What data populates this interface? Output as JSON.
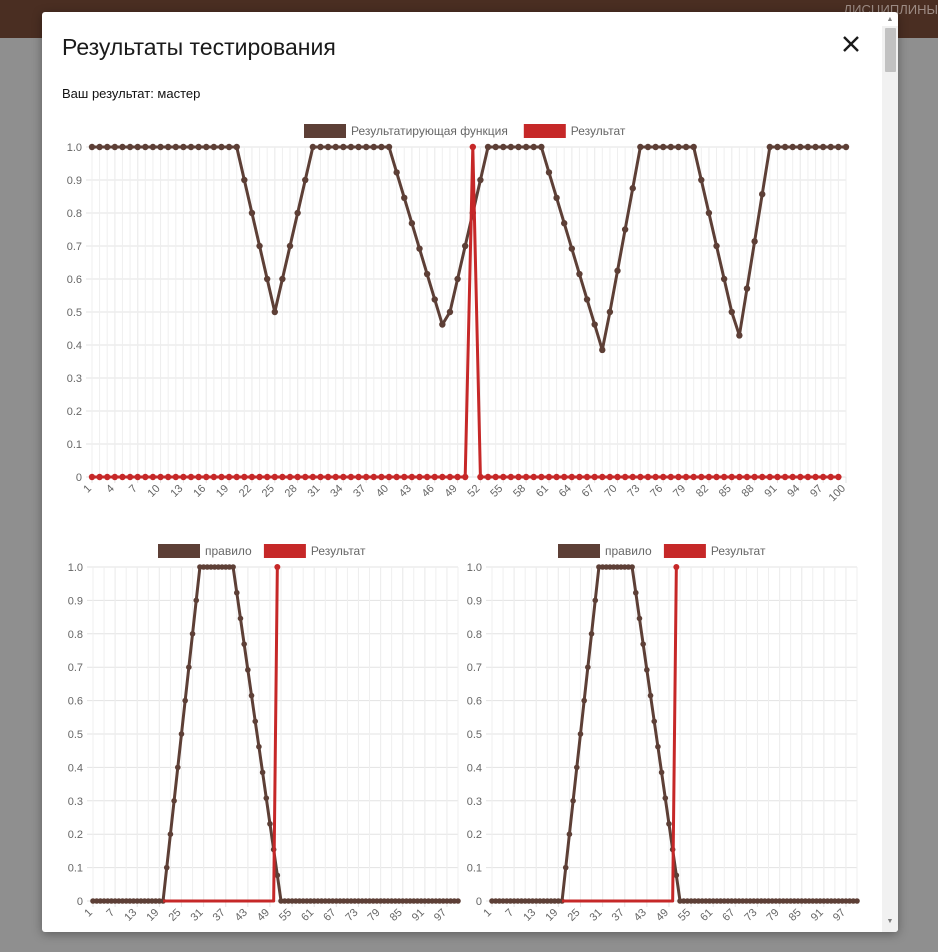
{
  "topbar": {
    "nav_text": "ДИСЦИПЛИНЫ"
  },
  "modal": {
    "title": "Результаты тестирования",
    "result_text": "Ваш результат: мастер"
  },
  "colors": {
    "brown": "#5d3f36",
    "red": "#c62828",
    "grid": "#e0e0e0",
    "tick": "#666666"
  },
  "icons": {
    "close": "close-icon"
  },
  "chart_data": [
    {
      "type": "line",
      "title": "",
      "x_start": 1,
      "x_end": 100,
      "x_step": 1,
      "x_tick_labels": [
        "1",
        "4",
        "7",
        "10",
        "13",
        "16",
        "19",
        "22",
        "25",
        "28",
        "31",
        "34",
        "37",
        "40",
        "43",
        "46",
        "49",
        "52",
        "55",
        "58",
        "61",
        "64",
        "67",
        "70",
        "73",
        "76",
        "79",
        "82",
        "85",
        "88",
        "91",
        "94",
        "97",
        "100"
      ],
      "ylim": [
        0,
        1
      ],
      "y_ticks": [
        "0",
        "0.1",
        "0.2",
        "0.3",
        "0.4",
        "0.5",
        "0.6",
        "0.7",
        "0.8",
        "0.9",
        "1.0"
      ],
      "grid": true,
      "legend_position": "top-center",
      "series": [
        {
          "name": "Результатирующая функция",
          "color": "#5d3f36",
          "marker": true,
          "values": [
            1,
            1,
            1,
            1,
            1,
            1,
            1,
            1,
            1,
            1,
            1,
            1,
            1,
            1,
            1,
            1,
            1,
            1,
            1,
            1,
            0.9,
            0.8,
            0.7,
            0.6,
            0.5,
            0.6,
            0.7,
            0.8,
            0.9,
            1,
            1,
            1,
            1,
            1,
            1,
            1,
            1,
            1,
            1,
            1,
            0.923,
            0.846,
            0.769,
            0.692,
            0.615,
            0.538,
            0.462,
            0.5,
            0.6,
            0.7,
            0.8,
            0.9,
            1,
            1,
            1,
            1,
            1,
            1,
            1,
            1,
            0.923,
            0.846,
            0.769,
            0.692,
            0.615,
            0.538,
            0.462,
            0.385,
            0.5,
            0.625,
            0.75,
            0.875,
            1,
            1,
            1,
            1,
            1,
            1,
            1,
            1,
            0.9,
            0.8,
            0.7,
            0.6,
            0.5,
            0.429,
            0.571,
            0.714,
            0.857,
            1,
            1,
            1,
            1,
            1,
            1,
            1,
            1,
            1,
            1,
            1
          ]
        },
        {
          "name": "Результат",
          "color": "#c62828",
          "marker": true,
          "spike_at": 51,
          "spike_value": 1,
          "baseline_value": 0,
          "x_end": 99
        }
      ]
    },
    {
      "type": "line",
      "title": "",
      "x_start": 1,
      "x_end": 100,
      "x_step": 1,
      "x_tick_labels": [
        "1",
        "7",
        "13",
        "19",
        "25",
        "31",
        "37",
        "43",
        "49",
        "55",
        "61",
        "67",
        "73",
        "79",
        "85",
        "91",
        "97"
      ],
      "ylim": [
        0,
        1
      ],
      "y_ticks": [
        "0",
        "0.1",
        "0.2",
        "0.3",
        "0.4",
        "0.5",
        "0.6",
        "0.7",
        "0.8",
        "0.9",
        "1.0"
      ],
      "grid": true,
      "legend_position": "top-center",
      "series": [
        {
          "name": "правило",
          "color": "#5d3f36",
          "marker": true,
          "rise_from": 20,
          "rise_to": 30,
          "fall_from": 39,
          "fall_to": 52
        },
        {
          "name": "Результат",
          "color": "#c62828",
          "marker": false,
          "spike_at": 51,
          "spike_value": 1,
          "baseline_value": 0,
          "x_start": 20,
          "x_end": 51
        }
      ]
    },
    {
      "type": "line",
      "title": "",
      "x_start": 1,
      "x_end": 100,
      "x_step": 1,
      "x_tick_labels": [
        "1",
        "7",
        "13",
        "19",
        "25",
        "31",
        "37",
        "43",
        "49",
        "55",
        "61",
        "67",
        "73",
        "79",
        "85",
        "91",
        "97"
      ],
      "ylim": [
        0,
        1
      ],
      "y_ticks": [
        "0",
        "0.1",
        "0.2",
        "0.3",
        "0.4",
        "0.5",
        "0.6",
        "0.7",
        "0.8",
        "0.9",
        "1.0"
      ],
      "grid": true,
      "legend_position": "top-center",
      "series": [
        {
          "name": "правило",
          "color": "#5d3f36",
          "marker": true,
          "rise_from": 20,
          "rise_to": 30,
          "fall_from": 39,
          "fall_to": 52
        },
        {
          "name": "Результат",
          "color": "#c62828",
          "marker": false,
          "spike_at": 51,
          "spike_value": 1,
          "baseline_value": 0,
          "x_start": 20,
          "x_end": 51
        }
      ]
    }
  ]
}
